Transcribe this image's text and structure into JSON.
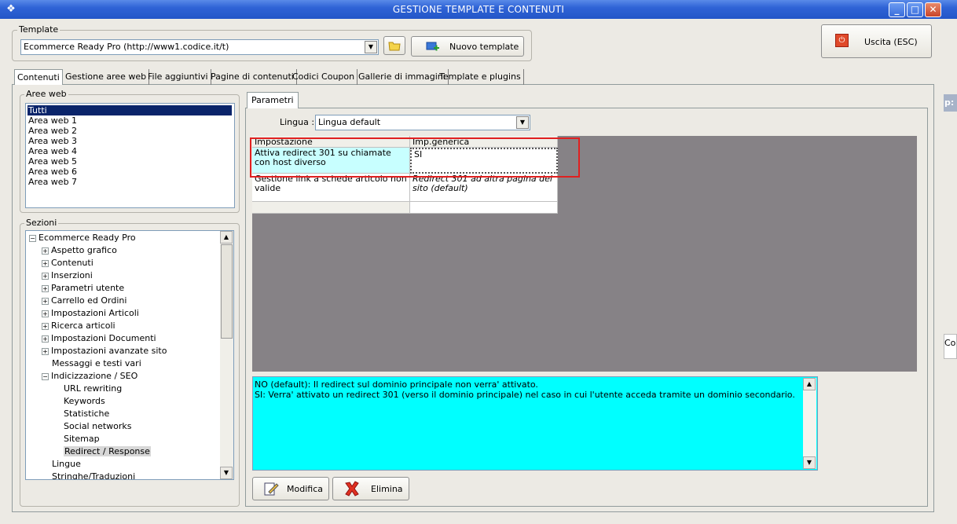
{
  "window": {
    "title": "GESTIONE TEMPLATE E CONTENUTI",
    "app_icon": "app-icon",
    "minimize_icon": "_",
    "maximize_icon": "□",
    "close_icon": "✕"
  },
  "template": {
    "group_label": "Template",
    "selected": "Ecommerce Ready Pro (http://www1.codice.it/t)",
    "open_icon": "folder-icon",
    "new_button_label": "Nuovo template"
  },
  "exit_button_label": "Uscita (ESC)",
  "tabs": [
    {
      "label": "Contenuti",
      "active": true
    },
    {
      "label": "Gestione aree web"
    },
    {
      "label": "File aggiuntivi"
    },
    {
      "label": "Pagine di contenuti"
    },
    {
      "label": "Codici Coupon"
    },
    {
      "label": "Gallerie di immagini"
    },
    {
      "label": "Template e plugins"
    }
  ],
  "aree_web": {
    "label": "Aree web",
    "items": [
      "Tutti",
      "Area web 1",
      "Area web 2",
      "Area web 3",
      "Area web 4",
      "Area web 5",
      "Area web 6",
      "Area web 7"
    ],
    "selected_index": 0
  },
  "sezioni": {
    "label": "Sezioni",
    "root": "Ecommerce Ready Pro",
    "items": [
      {
        "label": "Aspetto grafico",
        "expandable": true
      },
      {
        "label": "Contenuti",
        "expandable": true
      },
      {
        "label": "Inserzioni",
        "expandable": true
      },
      {
        "label": "Parametri utente",
        "expandable": true
      },
      {
        "label": "Carrello ed Ordini",
        "expandable": true
      },
      {
        "label": "Impostazioni Articoli",
        "expandable": true
      },
      {
        "label": "Ricerca articoli",
        "expandable": true
      },
      {
        "label": "Impostazioni Documenti",
        "expandable": true
      },
      {
        "label": "Impostazioni avanzate sito",
        "expandable": true
      },
      {
        "label": "Messaggi e testi vari",
        "expandable": false
      },
      {
        "label": "Indicizzazione / SEO",
        "expandable": true,
        "expanded": true
      }
    ],
    "seo_children": [
      "URL rewriting",
      "Keywords",
      "Statistiche",
      "Social networks",
      "Sitemap",
      "Redirect / Response"
    ],
    "after_items": [
      "Lingue",
      "Stringhe/Traduzioni"
    ],
    "selected": "Redirect / Response"
  },
  "parametri": {
    "tab_label": "Parametri",
    "lingua_label": "Lingua :",
    "lingua_value": "Lingua default",
    "grid": {
      "headers": [
        "Impostazione",
        "Imp.generica"
      ],
      "rows": [
        {
          "setting": "Attiva redirect 301 su chiamate con host diverso",
          "value": "SI"
        },
        {
          "setting": "Gestione link a schede articolo non valide",
          "value": "Redirect 301 ad altra pagina del sito (default)"
        },
        {
          "setting": "",
          "value": ""
        }
      ]
    },
    "description": [
      "NO (default): Il redirect sul dominio principale non verra' attivato.",
      "SI: Verra' attivato un redirect 301 (verso il dominio principale) nel caso in cui l'utente acceda tramite un dominio secondario."
    ],
    "modifica_label": "Modifica",
    "elimina_label": "Elimina"
  },
  "right_edge": {
    "top_text": "p:",
    "mid_text": "Co"
  },
  "colors": {
    "titlebar": "#2f63d6",
    "highlight": "#e02020",
    "desc_bg": "#00ffff",
    "grid_bg": "#868286"
  }
}
